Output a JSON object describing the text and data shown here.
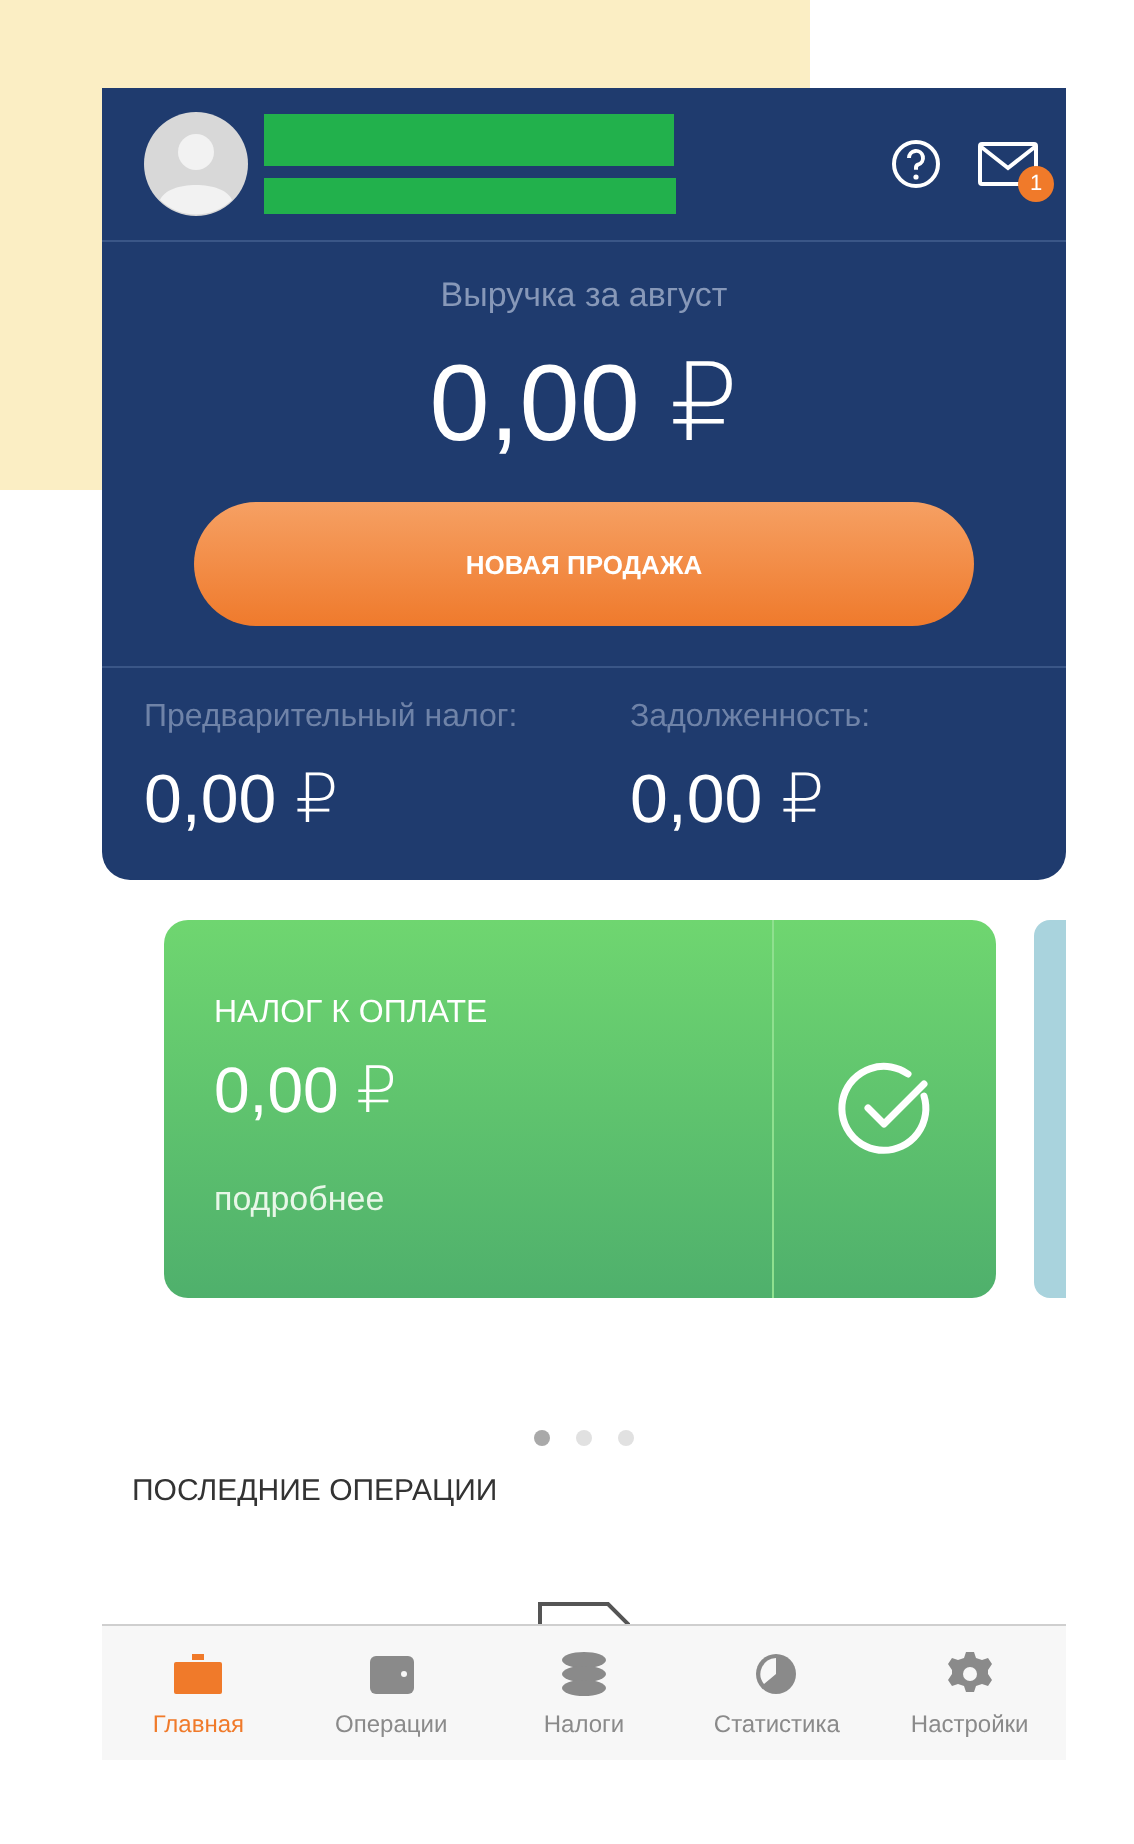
{
  "header": {
    "notification_count": "1"
  },
  "revenue": {
    "label": "Выручка за август",
    "amount": "0,00 ₽",
    "button": "НОВАЯ ПРОДАЖА"
  },
  "summary": [
    {
      "label": "Предварительный налог:",
      "value": "0,00 ₽"
    },
    {
      "label": "Задолженность:",
      "value": "0,00 ₽"
    }
  ],
  "tax_card": {
    "title": "НАЛОГ К ОПЛАТЕ",
    "amount": "0,00 ₽",
    "link": "подробнее"
  },
  "pager": [
    {
      "selected": true
    },
    {
      "selected": false
    },
    {
      "selected": false
    }
  ],
  "recent": {
    "title": "ПОСЛЕДНИЕ ОПЕРАЦИИ"
  },
  "tabs": [
    {
      "kind": "home",
      "label": "Главная",
      "selected": true
    },
    {
      "kind": "wallet",
      "label": "Операции",
      "selected": false
    },
    {
      "kind": "coins",
      "label": "Налоги",
      "selected": false
    },
    {
      "kind": "stats",
      "label": "Статистика",
      "selected": false
    },
    {
      "kind": "settings",
      "label": "Настройки",
      "selected": false
    }
  ]
}
